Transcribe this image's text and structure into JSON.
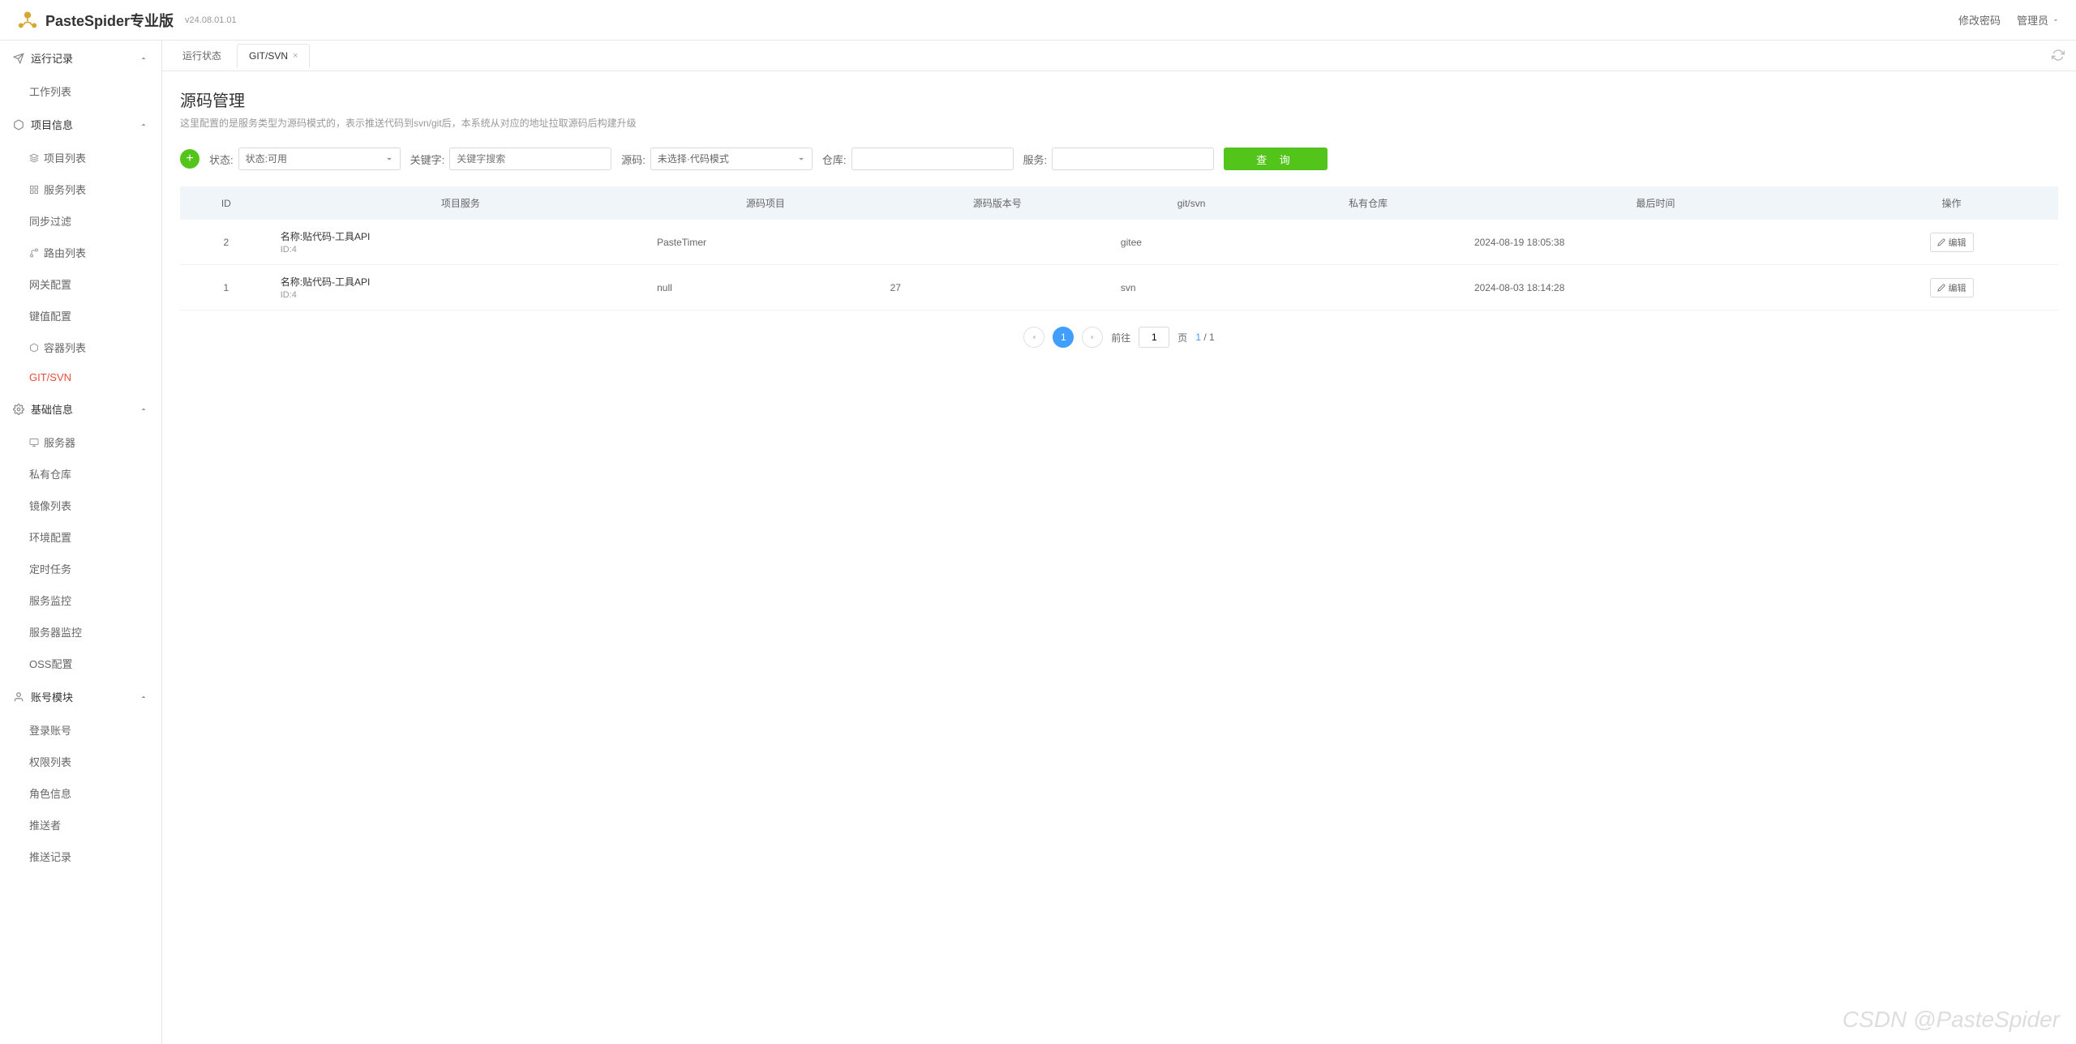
{
  "header": {
    "brand": "PasteSpider专业版",
    "version": "v24.08.01.01",
    "changePassword": "修改密码",
    "admin": "管理员"
  },
  "sidebar": {
    "groups": [
      {
        "label": "运行记录",
        "expanded": true,
        "items": [
          {
            "label": "工作列表"
          }
        ]
      },
      {
        "label": "项目信息",
        "expanded": true,
        "items": [
          {
            "label": "项目列表",
            "icon": "layers"
          },
          {
            "label": "服务列表",
            "icon": "grid"
          },
          {
            "label": "同步过滤"
          },
          {
            "label": "路由列表",
            "icon": "route"
          },
          {
            "label": "网关配置"
          },
          {
            "label": "键值配置"
          },
          {
            "label": "容器列表",
            "icon": "box"
          },
          {
            "label": "GIT/SVN",
            "active": true
          }
        ]
      },
      {
        "label": "基础信息",
        "expanded": true,
        "items": [
          {
            "label": "服务器",
            "icon": "monitor"
          },
          {
            "label": "私有仓库"
          },
          {
            "label": "镜像列表"
          },
          {
            "label": "环境配置"
          },
          {
            "label": "定时任务"
          },
          {
            "label": "服务监控"
          },
          {
            "label": "服务器监控"
          },
          {
            "label": "OSS配置"
          }
        ]
      },
      {
        "label": "账号模块",
        "expanded": true,
        "items": [
          {
            "label": "登录账号"
          },
          {
            "label": "权限列表"
          },
          {
            "label": "角色信息"
          },
          {
            "label": "推送者"
          },
          {
            "label": "推送记录"
          }
        ]
      }
    ]
  },
  "tabs": [
    {
      "label": "运行状态",
      "closable": false
    },
    {
      "label": "GIT/SVN",
      "closable": true,
      "active": true
    }
  ],
  "page": {
    "title": "源码管理",
    "description": "这里配置的是服务类型为源码模式的，表示推送代码到svn/git后，本系统从对应的地址拉取源码后构建升级"
  },
  "filters": {
    "statusLabel": "状态:",
    "statusValue": "状态:可用",
    "keywordLabel": "关键字:",
    "keywordPlaceholder": "关键字搜索",
    "sourceLabel": "源码:",
    "sourceValue": "未选择·代码模式",
    "repoLabel": "仓库:",
    "serviceLabel": "服务:",
    "searchBtn": "查 询"
  },
  "table": {
    "columns": [
      "ID",
      "项目服务",
      "源码项目",
      "源码版本号",
      "git/svn",
      "私有仓库",
      "最后时间",
      "操作"
    ],
    "rows": [
      {
        "id": "2",
        "project_name": "名称:贴代码-工具API",
        "project_sub": "ID:4",
        "source_project": "PasteTimer",
        "version": "",
        "gitsvn": "gitee",
        "private_repo": "",
        "last_time": "2024-08-19 18:05:38",
        "action": "编辑"
      },
      {
        "id": "1",
        "project_name": "名称:贴代码-工具API",
        "project_sub": "ID:4",
        "source_project": "null",
        "version": "27",
        "gitsvn": "svn",
        "private_repo": "",
        "last_time": "2024-08-03 18:14:28",
        "action": "编辑"
      }
    ]
  },
  "pagination": {
    "gotoLabel": "前往",
    "pageSuffix": "页",
    "current": "1",
    "currentDisplay": "1",
    "total": "1"
  },
  "watermark": "CSDN @PasteSpider"
}
